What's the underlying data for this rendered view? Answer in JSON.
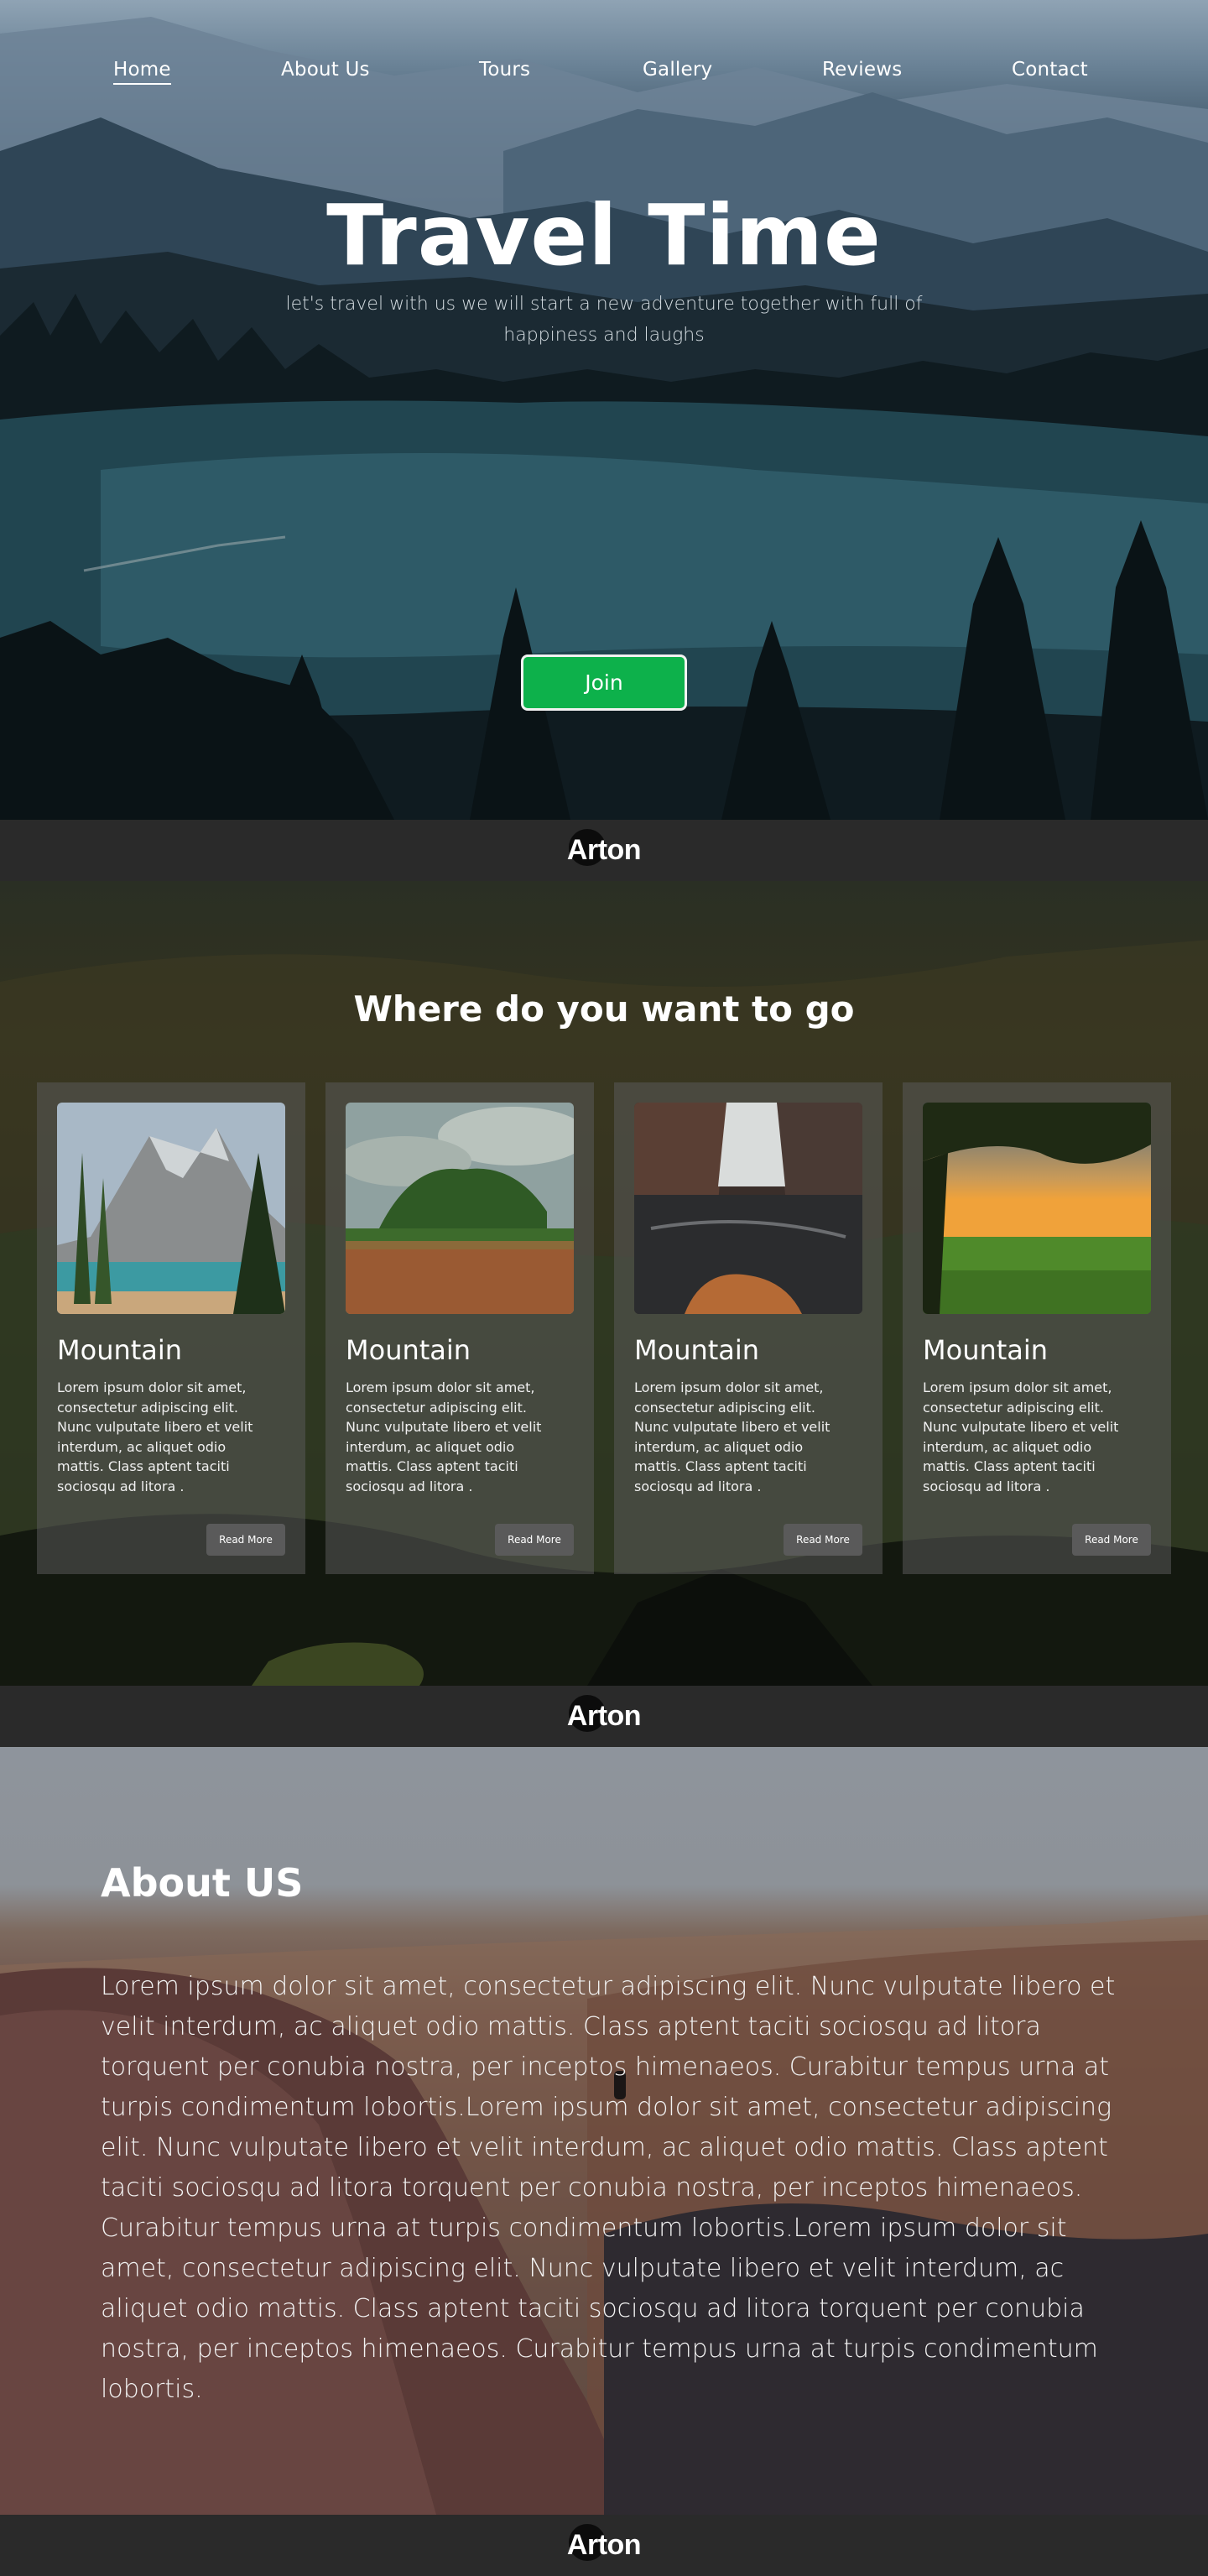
{
  "nav": {
    "items": [
      "Home",
      "About Us",
      "Tours",
      "Gallery",
      "Reviews",
      "Contact"
    ],
    "active": "Home"
  },
  "hero": {
    "title": "Travel Time",
    "subtitle": "let's travel with us we will start a new adventure together with full of happiness and laughs",
    "join_label": "Join"
  },
  "brand": {
    "name": "Arton"
  },
  "destinations": {
    "title": "Where do you want to go",
    "cards": [
      {
        "title": "Mountain",
        "text": "Lorem ipsum dolor sit amet, consectetur adipiscing elit. Nunc vulputate libero et velit interdum, ac aliquet odio mattis. Class aptent taciti sociosqu ad litora .",
        "button": "Read More",
        "image": "mountain-lake"
      },
      {
        "title": "Mountain",
        "text": "Lorem ipsum dolor sit amet, consectetur adipiscing elit. Nunc vulputate libero et velit interdum, ac aliquet odio mattis. Class aptent taciti sociosqu ad litora .",
        "button": "Read More",
        "image": "poppy-field"
      },
      {
        "title": "Mountain",
        "text": "Lorem ipsum dolor sit amet, consectetur adipiscing elit. Nunc vulputate libero et velit interdum, ac aliquet odio mattis. Class aptent taciti sociosqu ad litora .",
        "button": "Read More",
        "image": "waterfall"
      },
      {
        "title": "Mountain",
        "text": "Lorem ipsum dolor sit amet, consectetur adipiscing elit. Nunc vulputate libero et velit interdum, ac aliquet odio mattis. Class aptent taciti sociosqu ad litora .",
        "button": "Read More",
        "image": "sunset-field"
      }
    ]
  },
  "about": {
    "title": "About US",
    "text": "Lorem ipsum dolor sit amet, consectetur adipiscing elit. Nunc vulputate libero et velit interdum, ac aliquet odio mattis. Class aptent taciti sociosqu ad litora torquent per conubia nostra, per inceptos himenaeos. Curabitur tempus urna at turpis condimentum lobortis.Lorem ipsum dolor sit amet, consectetur adipiscing elit. Nunc vulputate libero et velit interdum, ac aliquet odio mattis. Class aptent taciti sociosqu ad litora torquent per conubia nostra, per inceptos himenaeos. Curabitur tempus urna at turpis condimentum lobortis.Lorem ipsum dolor sit amet, consectetur adipiscing elit. Nunc vulputate libero et velit interdum, ac aliquet odio mattis. Class aptent taciti sociosqu ad litora torquent per conubia nostra, per inceptos himenaeos. Curabitur tempus urna at turpis condimentum lobortis."
  },
  "colors": {
    "join_button": "#0db14b",
    "brand_bar": "#2a2a2a",
    "card_bg": "rgba(90,90,90,0.55)",
    "read_more_bg": "#5a5a5a"
  }
}
